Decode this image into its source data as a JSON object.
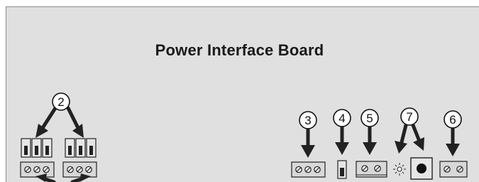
{
  "title": "Power Interface Board",
  "callouts": [
    {
      "id": "c2",
      "label": "2"
    },
    {
      "id": "c3",
      "label": "3"
    },
    {
      "id": "c4",
      "label": "4"
    },
    {
      "id": "c5",
      "label": "5"
    },
    {
      "id": "c7",
      "label": "7"
    },
    {
      "id": "c6",
      "label": "6"
    }
  ],
  "colors": {
    "board": "#e0e0e0",
    "ink": "#222222"
  },
  "components": [
    "jumper-header-icon",
    "terminal-block-icon",
    "fuse-icon",
    "screw-terminal-icon",
    "led-icon",
    "push-button-icon"
  ]
}
